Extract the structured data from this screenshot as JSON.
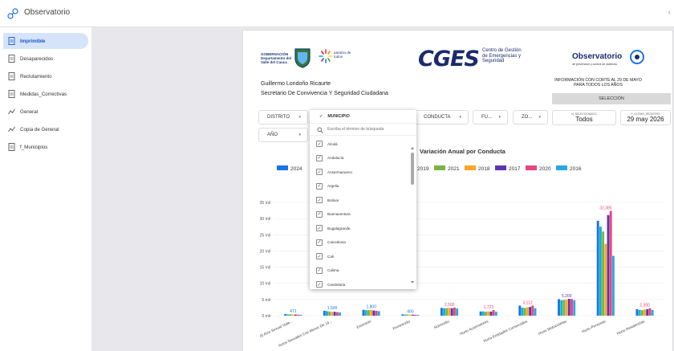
{
  "app": {
    "title": "Observatorio",
    "logo_icon": "observatorio-logo-icon"
  },
  "sidebar": {
    "items": [
      {
        "label": "Imprimible",
        "icon": "document-icon",
        "active": true
      },
      {
        "label": "Desaparecidos",
        "icon": "document-icon"
      },
      {
        "label": "Reclutamiento",
        "icon": "document-icon"
      },
      {
        "label": "Medidas_Correctivas",
        "icon": "document-icon"
      },
      {
        "label": "General",
        "icon": "line-chart-icon"
      },
      {
        "label": "Copia de General",
        "icon": "line-chart-icon"
      },
      {
        "label": "f_Municipios",
        "icon": "document-icon"
      }
    ]
  },
  "report": {
    "gobernacion": "GOBERNACIÓN Departamento del Valle del Cauca",
    "paraiso": "paraíso de todos",
    "cges": "CGES",
    "cges_sub": "Centro de Gestión de Emergencias y Seguridad",
    "observatorio": "Observatorio",
    "observatorio_sub": "de prevención y control de violencia",
    "person": "Guillermo Londoño Ricaurte",
    "role": "Secretario De Convivencia Y Seguridad Ciudadana",
    "corte": "INFORMACIÓN CON CORTE AL 29 DE MAYO PARA TODOS LOS AÑOS",
    "seleccion": "SELECCIÓN",
    "filters": [
      "DISTRITO",
      "CONDUCTA",
      "FU...",
      "ZO...",
      "AÑO"
    ],
    "kpi_selected": {
      "label": "N_SELECCIONADO",
      "value": "Todos"
    },
    "kpi_date": {
      "label": "F_ÚLTIMO_REGISTRO",
      "value": "29 may 2026"
    },
    "chart_title": "Variación Anual por Conducta"
  },
  "dropdown": {
    "header": "MUNICIPIO",
    "search_placeholder": "Escriba el término de búsqueda",
    "options": [
      "Alcalá",
      "Andalucía",
      "Ansermanuevo",
      "Argelia",
      "Bolívar",
      "Buenaventura",
      "Bugalagrande",
      "Caicedonia",
      "Cali",
      "Calima",
      "Candelaria"
    ]
  },
  "chart_data": {
    "type": "bar",
    "title": "Variación Anual por Conducta",
    "categories": [
      "(I) Acto Sexual Viole...",
      "Actos Sexuales Con Menor De 14...",
      "Extorsión",
      "Feminicidio",
      "Homicidio",
      "Hurto Automotores",
      "Hurto Entidades Comerciales",
      "Hurto Motocicletas",
      "Hurto Personas",
      "Hurto Residencias"
    ],
    "series": [
      {
        "name": "2024",
        "color": "#1a73e8",
        "values": [
          471,
          1500,
          1800,
          400,
          2400,
          1300,
          3100,
          5100,
          29300,
          2000
        ]
      },
      {
        "name": "2019",
        "color": "#12b5cb",
        "values": [
          400,
          1400,
          1700,
          350,
          2300,
          1300,
          2500,
          4800,
          27500,
          1800
        ]
      },
      {
        "name": "2021",
        "color": "#7cb342",
        "values": [
          420,
          1300,
          1700,
          330,
          2350,
          1200,
          2400,
          4900,
          26000,
          1700
        ]
      },
      {
        "name": "2018",
        "color": "#ffa726",
        "values": [
          380,
          1200,
          1800,
          320,
          2400,
          1300,
          2600,
          5000,
          22200,
          1900
        ]
      },
      {
        "name": "2017",
        "color": "#5e35b1",
        "values": [
          350,
          1200,
          1600,
          300,
          2300,
          1250,
          2700,
          5200,
          31098,
          2000
        ]
      },
      {
        "name": "2020",
        "color": "#e8467c",
        "values": [
          300,
          1100,
          1500,
          280,
          2500,
          1723,
          3112,
          5161,
          32385,
          2300
        ]
      },
      {
        "name": "2016",
        "color": "#29a8e0",
        "values": [
          280,
          1000,
          1400,
          250,
          2200,
          1200,
          2300,
          4800,
          18488,
          1800
        ]
      }
    ],
    "ylim": [
      0,
      35000
    ],
    "yticks": [
      "0 mil",
      "5 mil",
      "10 mil",
      "15 mil",
      "20 mil",
      "25 mil",
      "30 mil",
      "35 mil"
    ],
    "legend": "top"
  }
}
